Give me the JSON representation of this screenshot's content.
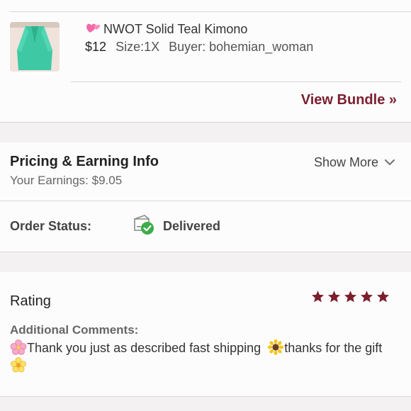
{
  "item": {
    "title": "NWOT Solid Teal Kimono",
    "price": "$12",
    "size": "Size:1X",
    "buyer": "Buyer: bohemian_woman"
  },
  "bundle_link": "View Bundle »",
  "pricing": {
    "title": "Pricing & Earning Info",
    "earnings": "Your Earnings: $9.05",
    "show_more": "Show More"
  },
  "order_status": {
    "label": "Order Status:",
    "value": "Delivered"
  },
  "rating": {
    "title": "Rating",
    "stars": 5,
    "comments_label": "Additional Comments:",
    "comment_part1": "Thank you just as described fast shipping",
    "comment_part2": "thanks for the gift"
  },
  "colors": {
    "accent": "#7b1f2e",
    "delivered_badge": "#3cad4a",
    "divider": "#d9d6d8"
  },
  "icons": [
    "heart-emoji-icon",
    "chevron-down-icon",
    "package-delivered-icon",
    "star-icon",
    "cherry-blossom-icon",
    "sunflower-icon",
    "blossom-icon"
  ]
}
